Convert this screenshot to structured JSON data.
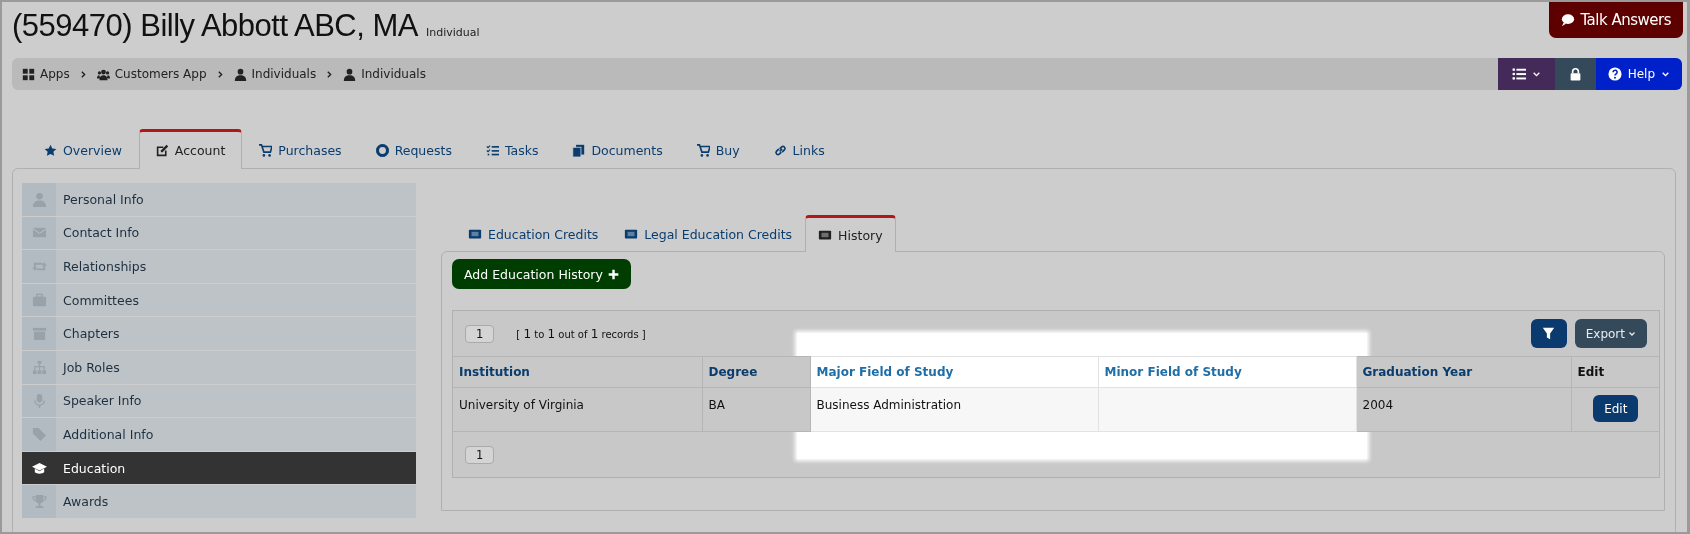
{
  "header": {
    "title": "(559470) Billy Abbott ABC, MA",
    "subtitle": "Individual",
    "talk_button": "Talk Answers"
  },
  "breadcrumb": [
    "Apps",
    "Customers App",
    "Individuals",
    "Individuals"
  ],
  "toolbar": {
    "help_label": "Help"
  },
  "tabs": [
    {
      "label": "Overview",
      "selected": false
    },
    {
      "label": "Account",
      "selected": true
    },
    {
      "label": "Purchases",
      "selected": false
    },
    {
      "label": "Requests",
      "selected": false
    },
    {
      "label": "Tasks",
      "selected": false
    },
    {
      "label": "Documents",
      "selected": false
    },
    {
      "label": "Buy",
      "selected": false
    },
    {
      "label": "Links",
      "selected": false
    }
  ],
  "sidebar": {
    "items": [
      {
        "label": "Personal Info",
        "selected": false
      },
      {
        "label": "Contact Info",
        "selected": false
      },
      {
        "label": "Relationships",
        "selected": false
      },
      {
        "label": "Committees",
        "selected": false
      },
      {
        "label": "Chapters",
        "selected": false
      },
      {
        "label": "Job Roles",
        "selected": false
      },
      {
        "label": "Speaker Info",
        "selected": false
      },
      {
        "label": "Additional Info",
        "selected": false
      },
      {
        "label": "Education",
        "selected": true
      },
      {
        "label": "Awards",
        "selected": false
      }
    ]
  },
  "subtabs": [
    {
      "label": "Education Credits",
      "selected": false
    },
    {
      "label": "Legal Education Credits",
      "selected": false
    },
    {
      "label": "History",
      "selected": true
    }
  ],
  "add_button": "Add Education History",
  "table": {
    "page": "1",
    "records": "[ **1** to **1** out of **1** records ]",
    "export_label": "Export",
    "columns": [
      {
        "label": "Institution",
        "highlighted": false
      },
      {
        "label": "Degree",
        "highlighted": false
      },
      {
        "label": "Major Field of Study",
        "highlighted": true
      },
      {
        "label": "Minor Field of Study",
        "highlighted": true
      },
      {
        "label": "Graduation Year",
        "highlighted": false
      },
      {
        "label": "Edit",
        "highlighted": false
      }
    ],
    "rows": [
      {
        "cells": [
          "University of Virginia",
          "BA",
          "Business Administration",
          "",
          "2004"
        ],
        "edit_label": "Edit"
      }
    ],
    "footer_page": "1"
  }
}
